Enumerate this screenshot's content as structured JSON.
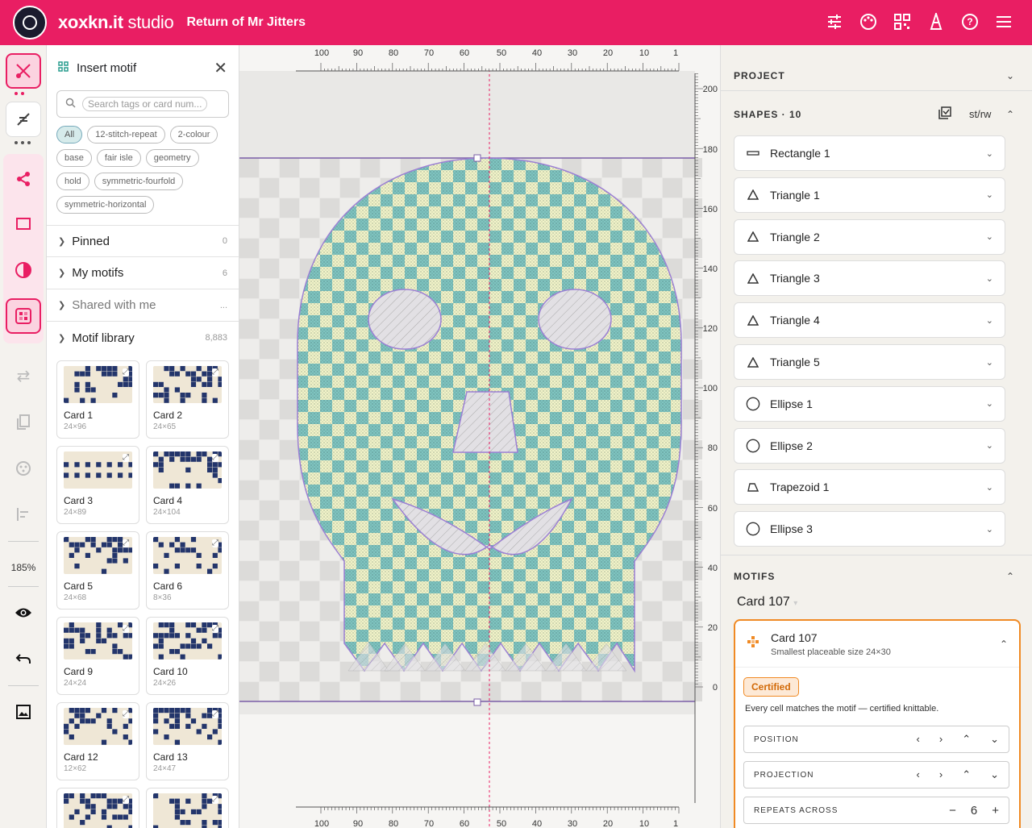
{
  "app": {
    "brand_bold": "xoxkn.it",
    "brand_light": " studio",
    "project_title": "Return of Mr Jitters"
  },
  "header_icons": [
    "tune-icon",
    "palette-icon",
    "qr-grid-icon",
    "cone-icon",
    "help-icon",
    "menu-icon"
  ],
  "rail": {
    "zoom": "185%"
  },
  "insert_panel": {
    "title": "Insert motif",
    "search_placeholder": "Search tags or card num...",
    "tags": [
      "All",
      "12-stitch-repeat",
      "2-colour",
      "base",
      "fair isle",
      "geometry",
      "hold",
      "symmetric-fourfold",
      "symmetric-horizontal"
    ],
    "sections": [
      {
        "label": "Pinned",
        "count": "0"
      },
      {
        "label": "My motifs",
        "count": "6"
      },
      {
        "label": "Shared with me",
        "count": "..."
      }
    ],
    "library": {
      "label": "Motif library",
      "count": "8,883"
    },
    "cards": [
      {
        "name": "Card 1",
        "size": "24×96"
      },
      {
        "name": "Card 2",
        "size": "24×65"
      },
      {
        "name": "Card 3",
        "size": "24×89"
      },
      {
        "name": "Card 4",
        "size": "24×104"
      },
      {
        "name": "Card 5",
        "size": "24×68"
      },
      {
        "name": "Card 6",
        "size": "8×36"
      },
      {
        "name": "Card 9",
        "size": "24×24"
      },
      {
        "name": "Card 10",
        "size": "24×26"
      },
      {
        "name": "Card 12",
        "size": "12×62"
      },
      {
        "name": "Card 13",
        "size": "24×47"
      },
      {
        "name": "",
        "size": ""
      },
      {
        "name": "",
        "size": ""
      }
    ]
  },
  "canvas": {
    "top_ruler": [
      "100",
      "90",
      "80",
      "70",
      "60",
      "50",
      "40",
      "30",
      "20",
      "10",
      "1"
    ],
    "right_ruler": [
      "200",
      "180",
      "160",
      "140",
      "120",
      "100",
      "80",
      "60",
      "40",
      "20",
      "0"
    ],
    "colors": {
      "teal": "#7fc4c0",
      "cream": "#f1f3c8",
      "outline": "#9b7fd4",
      "guide": "#e91e63"
    }
  },
  "right_panel": {
    "project_label": "PROJECT",
    "shapes_label": "SHAPES · 10",
    "shapes_tool": "st/rw",
    "shapes": [
      {
        "name": "Rectangle 1",
        "icon": "rectangle-icon"
      },
      {
        "name": "Triangle 1",
        "icon": "triangle-icon"
      },
      {
        "name": "Triangle 2",
        "icon": "triangle-icon"
      },
      {
        "name": "Triangle 3",
        "icon": "triangle-icon"
      },
      {
        "name": "Triangle 4",
        "icon": "triangle-icon"
      },
      {
        "name": "Triangle 5",
        "icon": "triangle-icon"
      },
      {
        "name": "Ellipse 1",
        "icon": "ellipse-icon"
      },
      {
        "name": "Ellipse 2",
        "icon": "ellipse-icon"
      },
      {
        "name": "Trapezoid 1",
        "icon": "trapezoid-icon"
      },
      {
        "name": "Ellipse 3",
        "icon": "ellipse-icon"
      }
    ],
    "motifs_label": "MOTIFS",
    "motif_select": "Card 107",
    "motif_card": {
      "title": "Card 107",
      "subtitle": "Smallest placeable size 24×30",
      "badge": "Certified",
      "note": "Every cell matches the motif — certified knittable.",
      "position_label": "POSITION",
      "projection_label": "PROJECTION",
      "repeats_label": "REPEATS ACROSS",
      "repeats_value": "6"
    }
  }
}
